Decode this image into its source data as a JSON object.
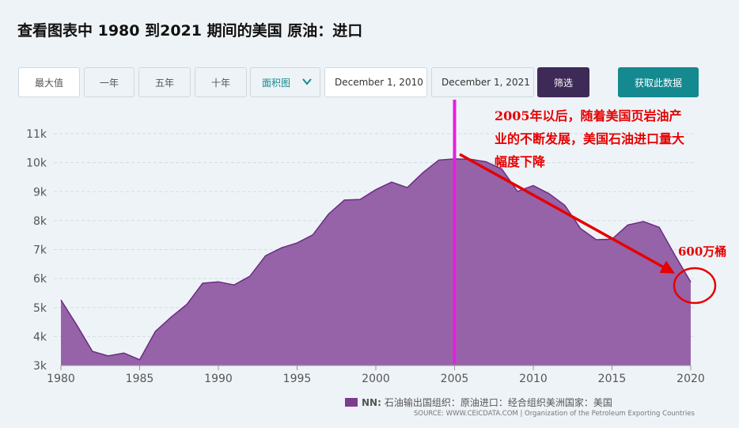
{
  "page": {
    "title": "查看图表中 1980 到2021 期间的美国 原油：进口"
  },
  "toolbar": {
    "max_label": "最大值",
    "one_year_label": "一年",
    "five_year_label": "五年",
    "ten_year_label": "十年",
    "chart_type_value": "面积图",
    "start_date": "December 1, 2010",
    "end_date": "December 1, 2021",
    "filter_label": "筛选",
    "get_data_label": "获取此数据"
  },
  "legend": {
    "series_code": "NN:",
    "series_text": "石油输出国组织：原油进口：经合组织美洲国家：美国"
  },
  "source": "SOURCE: WWW.CEICDATA.COM | Organization of the Petroleum Exporting Countries",
  "annotations": {
    "note_lines": [
      "2005年以后，随着美国页岩油产",
      "业的不断发展，美国石油进口量大",
      "幅度下降"
    ],
    "circle_label": "600万桶",
    "marker_year": 2005
  },
  "colors": {
    "area_fill": "#8a4f9e",
    "area_line": "#6b2d80",
    "annotation_red": "#e60000",
    "marker_magenta": "#e81ee0"
  },
  "chart_data": {
    "type": "area",
    "x": [
      1980,
      1981,
      1982,
      1983,
      1984,
      1985,
      1986,
      1987,
      1988,
      1989,
      1990,
      1991,
      1992,
      1993,
      1994,
      1995,
      1996,
      1997,
      1998,
      1999,
      2000,
      2001,
      2002,
      2003,
      2004,
      2005,
      2006,
      2007,
      2008,
      2009,
      2010,
      2011,
      2012,
      2013,
      2014,
      2015,
      2016,
      2017,
      2018,
      2019,
      2020
    ],
    "values": [
      5260,
      4400,
      3490,
      3330,
      3430,
      3200,
      4180,
      4670,
      5110,
      5840,
      5890,
      5780,
      6080,
      6790,
      7060,
      7230,
      7510,
      8230,
      8710,
      8730,
      9070,
      9330,
      9140,
      9660,
      10090,
      10130,
      10120,
      10030,
      9780,
      9010,
      9210,
      8930,
      8530,
      7730,
      7340,
      7360,
      7850,
      7970,
      7770,
      6800,
      5880
    ],
    "xlim": [
      1980,
      2020
    ],
    "ylim": [
      3000,
      11000
    ],
    "x_ticks": [
      1980,
      1985,
      1990,
      1995,
      2000,
      2005,
      2010,
      2015,
      2020
    ],
    "y_ticks": [
      3000,
      4000,
      5000,
      6000,
      7000,
      8000,
      9000,
      10000,
      11000
    ],
    "y_tick_labels": [
      "3k",
      "4k",
      "5k",
      "6k",
      "7k",
      "8k",
      "9k",
      "10k",
      "11k"
    ],
    "grid": true,
    "legend_position": "bottom"
  }
}
